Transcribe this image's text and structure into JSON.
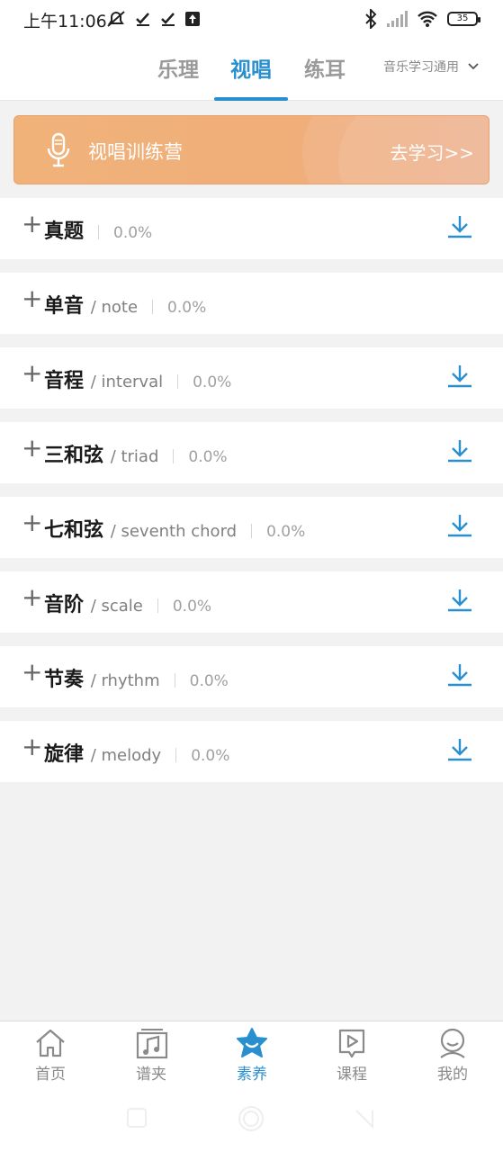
{
  "status_bar": {
    "time": "上午11:06",
    "battery": "35"
  },
  "top_nav": {
    "tabs": [
      {
        "label": "乐理",
        "active": false
      },
      {
        "label": "视唱",
        "active": true
      },
      {
        "label": "练耳",
        "active": false
      }
    ],
    "level_select": "音乐学习通用"
  },
  "banner": {
    "title": "视唱训练营",
    "action": "去学习>>",
    "icon": "microphone-icon"
  },
  "rows": [
    {
      "name": "真题",
      "en": "",
      "percent": "0.0%",
      "download": true
    },
    {
      "name": "单音",
      "en": "/ note",
      "percent": "0.0%",
      "download": false
    },
    {
      "name": "音程",
      "en": "/ interval",
      "percent": "0.0%",
      "download": true
    },
    {
      "name": "三和弦",
      "en": "/ triad",
      "percent": "0.0%",
      "download": true
    },
    {
      "name": "七和弦",
      "en": "/ seventh chord",
      "percent": "0.0%",
      "download": true
    },
    {
      "name": "音阶",
      "en": "/ scale",
      "percent": "0.0%",
      "download": true
    },
    {
      "name": "节奏",
      "en": "/ rhythm",
      "percent": "0.0%",
      "download": true
    },
    {
      "name": "旋律",
      "en": "/ melody",
      "percent": "0.0%",
      "download": true
    }
  ],
  "bottom_nav": [
    {
      "label": "首页",
      "icon": "home-icon",
      "active": false
    },
    {
      "label": "谱夹",
      "icon": "music-folder-icon",
      "active": false
    },
    {
      "label": "素养",
      "icon": "star-icon",
      "active": true
    },
    {
      "label": "课程",
      "icon": "play-course-icon",
      "active": false
    },
    {
      "label": "我的",
      "icon": "profile-icon",
      "active": false
    }
  ],
  "colors": {
    "accent": "#2a8fcf",
    "banner": "#f0ae78"
  }
}
